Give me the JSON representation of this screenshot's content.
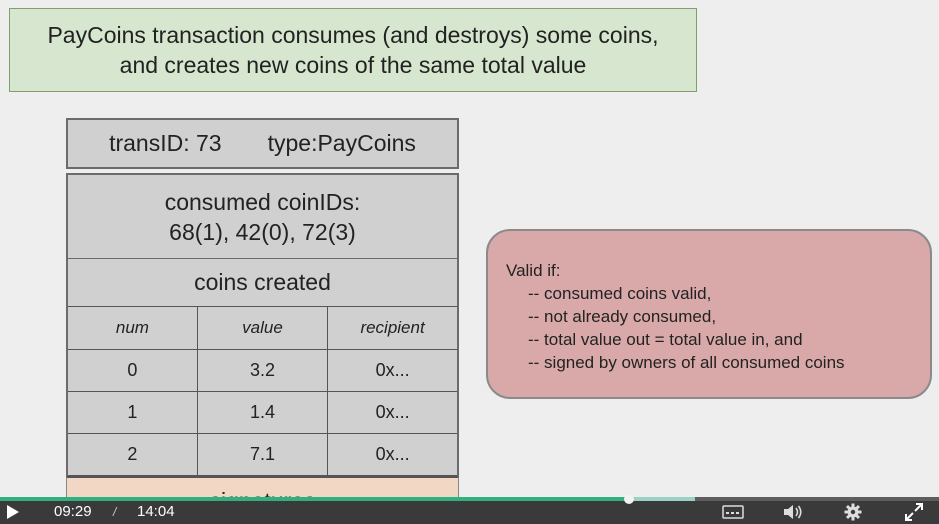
{
  "slide": {
    "title_line1": "PayCoins transaction consumes (and destroys) some coins,",
    "title_line2": "and creates new coins of the same total value",
    "transaction": {
      "trans_id": "transID: 73",
      "type": "type:PayCoins",
      "consumed_label": "consumed coinIDs:",
      "consumed_ids": "68(1), 42(0), 72(3)",
      "created_label": "coins created",
      "columns": [
        "num",
        "value",
        "recipient"
      ],
      "rows": [
        [
          "0",
          "3.2",
          "0x..."
        ],
        [
          "1",
          "1.4",
          "0x..."
        ],
        [
          "2",
          "7.1",
          "0x..."
        ]
      ],
      "signatures_label": "signatures"
    },
    "validity": {
      "heading": "Valid if:",
      "items": [
        "-- consumed coins valid,",
        "-- not already consumed,",
        "-- total value out = total value in, and",
        "-- signed by owners of all consumed coins"
      ]
    }
  },
  "player": {
    "current_time": "09:29",
    "separator": "/",
    "duration": "14:04",
    "progress_fraction": 0.67,
    "buffered_fraction": 0.74,
    "icons": [
      "play-icon",
      "captions-icon",
      "volume-icon",
      "settings-icon",
      "fullscreen-icon"
    ],
    "colors": {
      "progress": "#2fb07f",
      "bar": "#3a3a3a"
    }
  }
}
